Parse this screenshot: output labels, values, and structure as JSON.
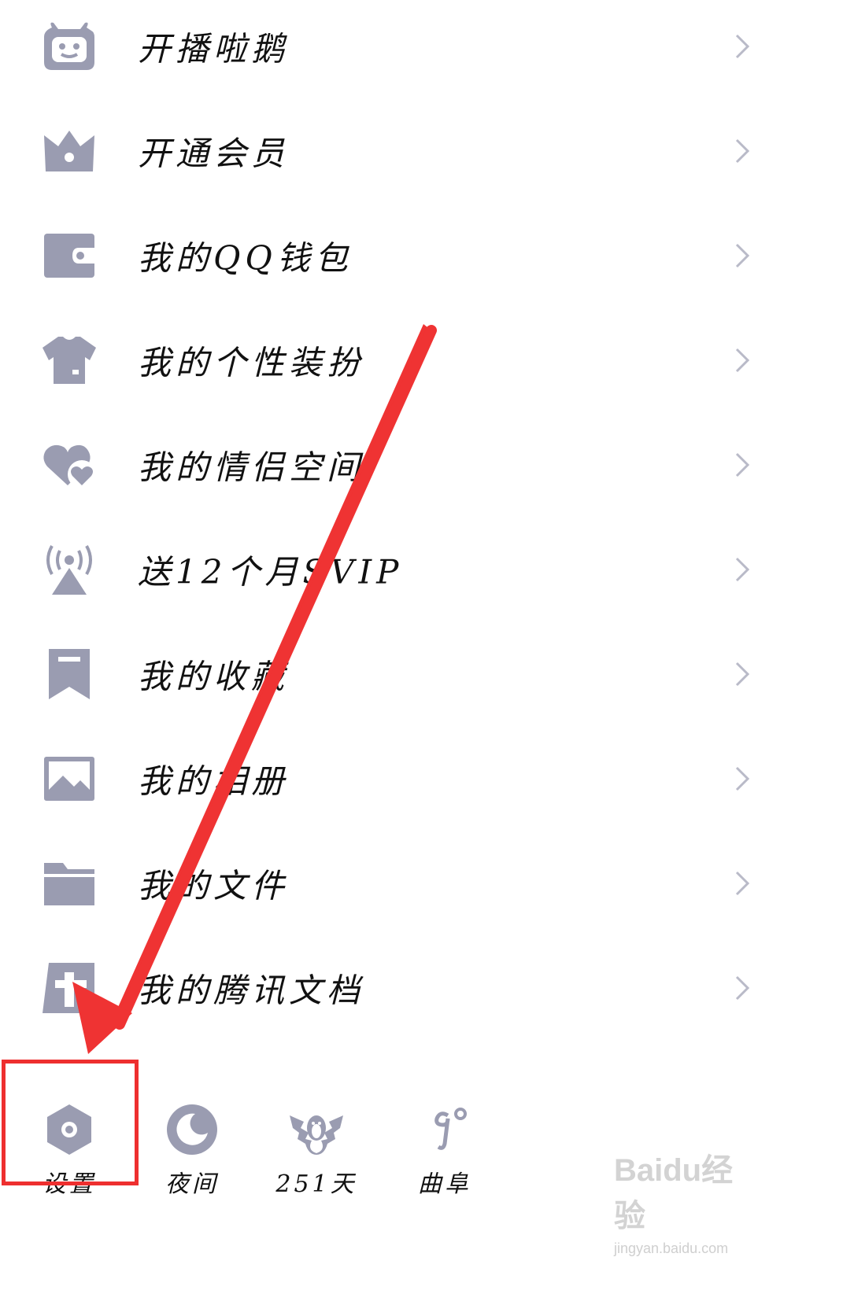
{
  "colors": {
    "icon": "#9a9cb1",
    "arrow": "#ef3333",
    "highlight": "#ee2f2f",
    "chevron": "#b9bac8"
  },
  "menu": {
    "items": [
      {
        "label": "开播啦鹅",
        "icon": "tv-robot-icon"
      },
      {
        "label": "开通会员",
        "icon": "crown-icon"
      },
      {
        "label": "我的QQ钱包",
        "icon": "wallet-icon"
      },
      {
        "label": "我的个性装扮",
        "icon": "tshirt-icon"
      },
      {
        "label": "我的情侣空间",
        "icon": "hearts-icon"
      },
      {
        "label": "送12个月SVIP",
        "icon": "broadcast-tower-icon"
      },
      {
        "label": "我的收藏",
        "icon": "bookmark-icon"
      },
      {
        "label": "我的相册",
        "icon": "image-icon"
      },
      {
        "label": "我的文件",
        "icon": "folder-icon"
      },
      {
        "label": "我的腾讯文档",
        "icon": "tencent-docs-icon"
      }
    ]
  },
  "bottom_bar": {
    "items": [
      {
        "label": "设置",
        "icon": "settings-hexagon-icon"
      },
      {
        "label": "夜间",
        "icon": "moon-icon"
      },
      {
        "label": "251天",
        "icon": "winged-penguin-icon"
      },
      {
        "label": "曲阜",
        "icon": "weather-icon"
      }
    ]
  },
  "watermark": {
    "brand": "Baidu经验",
    "url": "jingyan.baidu.com"
  }
}
